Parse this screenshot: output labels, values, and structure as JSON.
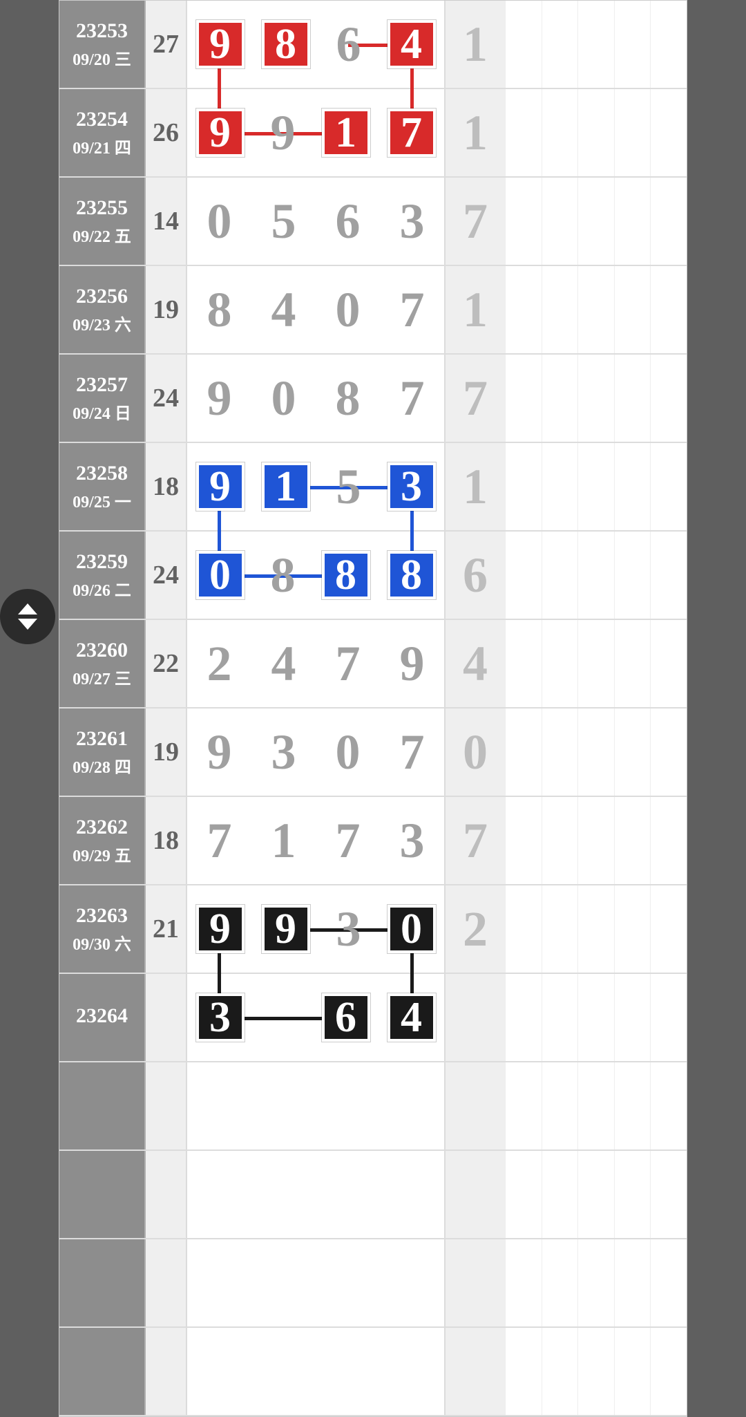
{
  "colors": {
    "red": "#d82a2a",
    "blue": "#1f55d6",
    "black": "#1a1a1a"
  },
  "rows": [
    {
      "issue": "23253",
      "date": "09/20 三",
      "sum": "27",
      "digits": [
        {
          "v": "9",
          "hl": "red"
        },
        {
          "v": "8",
          "hl": "red"
        },
        {
          "v": "6",
          "hl": null
        },
        {
          "v": "4",
          "hl": "red"
        }
      ],
      "extra": "1"
    },
    {
      "issue": "23254",
      "date": "09/21 四",
      "sum": "26",
      "digits": [
        {
          "v": "9",
          "hl": "red"
        },
        {
          "v": "9",
          "hl": null
        },
        {
          "v": "1",
          "hl": "red"
        },
        {
          "v": "7",
          "hl": "red"
        }
      ],
      "extra": "1"
    },
    {
      "issue": "23255",
      "date": "09/22 五",
      "sum": "14",
      "digits": [
        {
          "v": "0",
          "hl": null
        },
        {
          "v": "5",
          "hl": null
        },
        {
          "v": "6",
          "hl": null
        },
        {
          "v": "3",
          "hl": null
        }
      ],
      "extra": "7"
    },
    {
      "issue": "23256",
      "date": "09/23 六",
      "sum": "19",
      "digits": [
        {
          "v": "8",
          "hl": null
        },
        {
          "v": "4",
          "hl": null
        },
        {
          "v": "0",
          "hl": null
        },
        {
          "v": "7",
          "hl": null
        }
      ],
      "extra": "1"
    },
    {
      "issue": "23257",
      "date": "09/24 日",
      "sum": "24",
      "digits": [
        {
          "v": "9",
          "hl": null
        },
        {
          "v": "0",
          "hl": null
        },
        {
          "v": "8",
          "hl": null
        },
        {
          "v": "7",
          "hl": null
        }
      ],
      "extra": "7"
    },
    {
      "issue": "23258",
      "date": "09/25 一",
      "sum": "18",
      "digits": [
        {
          "v": "9",
          "hl": "blue"
        },
        {
          "v": "1",
          "hl": "blue"
        },
        {
          "v": "5",
          "hl": null
        },
        {
          "v": "3",
          "hl": "blue"
        }
      ],
      "extra": "1"
    },
    {
      "issue": "23259",
      "date": "09/26 二",
      "sum": "24",
      "digits": [
        {
          "v": "0",
          "hl": "blue"
        },
        {
          "v": "8",
          "hl": null
        },
        {
          "v": "8",
          "hl": "blue"
        },
        {
          "v": "8",
          "hl": "blue"
        }
      ],
      "extra": "6"
    },
    {
      "issue": "23260",
      "date": "09/27 三",
      "sum": "22",
      "digits": [
        {
          "v": "2",
          "hl": null
        },
        {
          "v": "4",
          "hl": null
        },
        {
          "v": "7",
          "hl": null
        },
        {
          "v": "9",
          "hl": null
        }
      ],
      "extra": "4"
    },
    {
      "issue": "23261",
      "date": "09/28 四",
      "sum": "19",
      "digits": [
        {
          "v": "9",
          "hl": null
        },
        {
          "v": "3",
          "hl": null
        },
        {
          "v": "0",
          "hl": null
        },
        {
          "v": "7",
          "hl": null
        }
      ],
      "extra": "0"
    },
    {
      "issue": "23262",
      "date": "09/29 五",
      "sum": "18",
      "digits": [
        {
          "v": "7",
          "hl": null
        },
        {
          "v": "1",
          "hl": null
        },
        {
          "v": "7",
          "hl": null
        },
        {
          "v": "3",
          "hl": null
        }
      ],
      "extra": "7"
    },
    {
      "issue": "23263",
      "date": "09/30 六",
      "sum": "21",
      "digits": [
        {
          "v": "9",
          "hl": "black"
        },
        {
          "v": "9",
          "hl": "black"
        },
        {
          "v": "3",
          "hl": null
        },
        {
          "v": "0",
          "hl": "black"
        }
      ],
      "extra": "2"
    },
    {
      "issue": "23264",
      "date": "",
      "sum": "",
      "digits": [
        {
          "v": "3",
          "hl": "black"
        },
        {
          "v": "",
          "hl": null
        },
        {
          "v": "6",
          "hl": "black"
        },
        {
          "v": "4",
          "hl": "black"
        }
      ],
      "extra": ""
    }
  ],
  "connectors": [
    {
      "color": "red",
      "type": "h",
      "row": 0,
      "fromCol": 2,
      "toCol": 3
    },
    {
      "color": "red",
      "type": "v",
      "col": 0,
      "fromRow": 0,
      "toRow": 1
    },
    {
      "color": "red",
      "type": "v",
      "col": 3,
      "fromRow": 0,
      "toRow": 1
    },
    {
      "color": "red",
      "type": "h",
      "row": 1,
      "fromCol": 0,
      "toCol": 2
    },
    {
      "color": "blue",
      "type": "h",
      "row": 5,
      "fromCol": 1,
      "toCol": 3
    },
    {
      "color": "blue",
      "type": "v",
      "col": 0,
      "fromRow": 5,
      "toRow": 6
    },
    {
      "color": "blue",
      "type": "v",
      "col": 3,
      "fromRow": 5,
      "toRow": 6
    },
    {
      "color": "blue",
      "type": "h",
      "row": 6,
      "fromCol": 0,
      "toCol": 2
    },
    {
      "color": "black",
      "type": "h",
      "row": 10,
      "fromCol": 1,
      "toCol": 3
    },
    {
      "color": "black",
      "type": "v",
      "col": 0,
      "fromRow": 10,
      "toRow": 11
    },
    {
      "color": "black",
      "type": "v",
      "col": 3,
      "fromRow": 10,
      "toRow": 11
    },
    {
      "color": "black",
      "type": "h",
      "row": 11,
      "fromCol": 0,
      "toCol": 2
    }
  ],
  "emptyTrailingRows": 4
}
